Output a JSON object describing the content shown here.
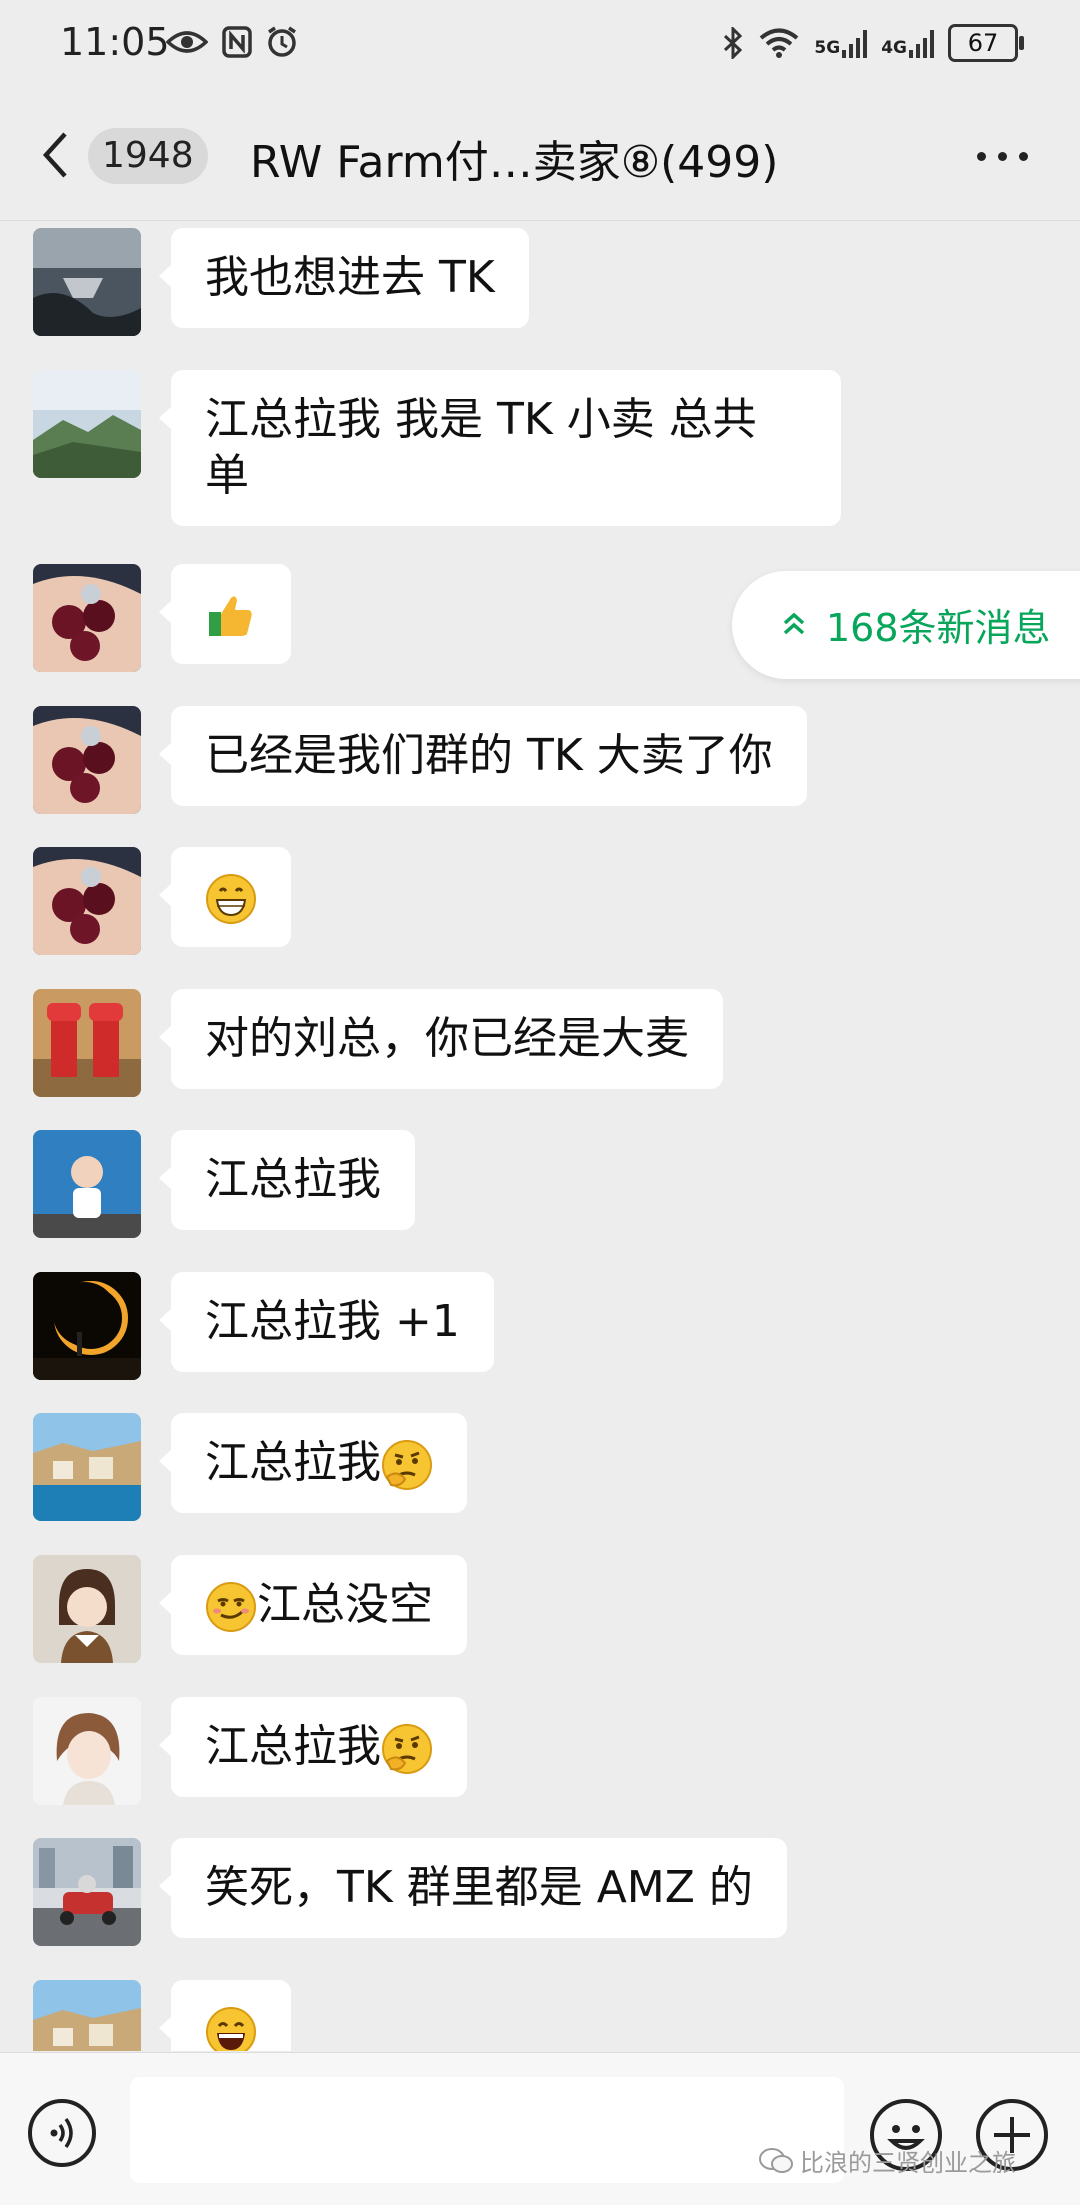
{
  "status_bar": {
    "time": "11:05",
    "net1": "5G",
    "net2": "4G",
    "battery": "67"
  },
  "header": {
    "unread_badge": "1948",
    "title": "RW Farm付…卖家⑧(499)"
  },
  "new_messages": {
    "label": "168条新消息"
  },
  "messages": [
    {
      "avatar": "avatar-sea-rocks",
      "text": "我也想进去 TK"
    },
    {
      "avatar": "avatar-mountains",
      "text": "江总拉我 我是 TK 小卖 总共",
      "text2": "单"
    },
    {
      "avatar": "avatar-bayberries",
      "emoji": "thumbs-up-emoji"
    },
    {
      "avatar": "avatar-bayberries",
      "text": "已经是我们群的 TK 大卖了你"
    },
    {
      "avatar": "avatar-bayberries",
      "emoji": "grin-emoji"
    },
    {
      "avatar": "avatar-red-lanterns",
      "text": "对的刘总，你已经是大麦"
    },
    {
      "avatar": "avatar-child-blue-wall",
      "text": "江总拉我"
    },
    {
      "avatar": "avatar-eclipse",
      "text": "江总拉我 +1"
    },
    {
      "avatar": "avatar-coastal-town",
      "text": "江总拉我",
      "emoji_after": "thinking-emoji"
    },
    {
      "avatar": "avatar-girl",
      "emoji_before": "smirk-emoji",
      "text": "江总没空"
    },
    {
      "avatar": "avatar-bob-hair-girl",
      "text": "江总拉我",
      "emoji_after": "thinking-emoji"
    },
    {
      "avatar": "avatar-go-kart",
      "text": "笑死，TK 群里都是 AMZ 的"
    },
    {
      "avatar": "avatar-coastal-town",
      "emoji": "laugh-emoji"
    }
  ],
  "input_bar": {
    "watermark": "比浪的三贤创业之旅"
  },
  "colors": {
    "accent_green": "#07a65a",
    "background": "#ededed",
    "bubble": "#ffffff"
  }
}
